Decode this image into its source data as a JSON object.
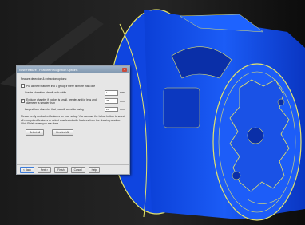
{
  "dialog": {
    "title": "New Feature - Feature Recognition Options",
    "close_glyph": "x",
    "heading": "Feature detection & extraction options:",
    "options": [
      {
        "label": "Put all new features into a group if there is more than one",
        "checked": false
      },
      {
        "label": "Create chamfers (detail) with width",
        "value": "1",
        "unit": "mm"
      },
      {
        "label": "Exclude chamfer if pocket is small, greater and/or less and diameter is smaller than",
        "checked": true,
        "value": "25",
        "unit": "mm"
      },
      {
        "label": "Largest turn diameter that you will consider using",
        "value": "25",
        "unit": "mm"
      }
    ],
    "instructions": "Please verify and select features for your setup. You can use the below button to select all recognized features or select unselected with features from the drawing window. Click Finish when you are done.",
    "select_all": "Select All",
    "unselect_all": "Unselect All",
    "footer": {
      "back": "< Back",
      "next": "Next >",
      "finish": "Finish",
      "cancel": "Cancel",
      "help": "Help"
    }
  }
}
